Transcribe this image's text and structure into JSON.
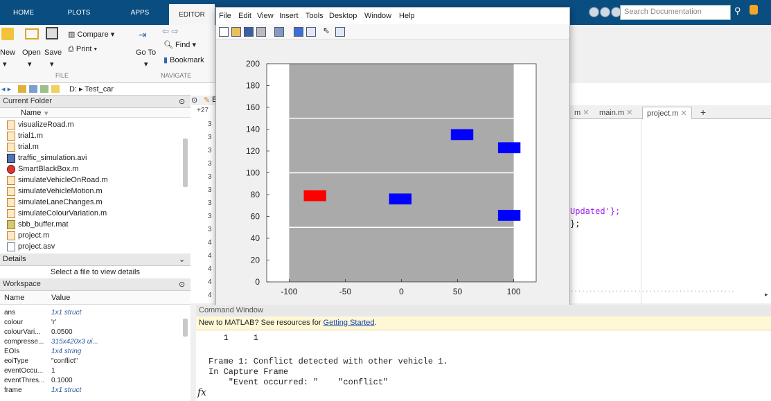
{
  "top_tabs": [
    "HOME",
    "PLOTS",
    "APPS",
    "EDITOR"
  ],
  "search": {
    "placeholder": "Search Documentation"
  },
  "ribbon": {
    "compare": "Compare",
    "new": "New",
    "open": "Open",
    "save": "Save",
    "print": "Print",
    "goto": "Go To",
    "find": "Find",
    "bookmark": "Bookmark",
    "group_file": "FILE",
    "group_navigate": "NAVIGATE"
  },
  "address": {
    "path": "D: ▸ Test_car"
  },
  "current_folder": {
    "title": "Current Folder",
    "column_name": "Name",
    "files": [
      {
        "name": "visualizeRoad.m",
        "type": "m"
      },
      {
        "name": "trial1.m",
        "type": "m"
      },
      {
        "name": "trial.m",
        "type": "m"
      },
      {
        "name": "traffic_simulation.avi",
        "type": "avi"
      },
      {
        "name": "SmartBlackBox.m",
        "type": "sbb"
      },
      {
        "name": "simulateVehicleOnRoad.m",
        "type": "m"
      },
      {
        "name": "simulateVehicleMotion.m",
        "type": "m"
      },
      {
        "name": "simulateLaneChanges.m",
        "type": "m"
      },
      {
        "name": "simulateColourVariation.m",
        "type": "m"
      },
      {
        "name": "sbb_buffer.mat",
        "type": "mat"
      },
      {
        "name": "project.m",
        "type": "m"
      },
      {
        "name": "project.asv",
        "type": "file"
      }
    ]
  },
  "details": {
    "title": "Details",
    "message": "Select a file to view details"
  },
  "workspace": {
    "title": "Workspace",
    "col_name": "Name",
    "col_value": "Value",
    "rows": [
      {
        "name": "ans",
        "value": "1x1 struct",
        "meta": true
      },
      {
        "name": "colour",
        "value": "'r'",
        "meta": false
      },
      {
        "name": "colourVari...",
        "value": "0.0500",
        "meta": false
      },
      {
        "name": "compresse...",
        "value": "315x420x3 ui...",
        "meta": true
      },
      {
        "name": "EOIs",
        "value": "1x4 string",
        "meta": true
      },
      {
        "name": "eoiType",
        "value": "\"conflict\"",
        "meta": false
      },
      {
        "name": "eventOccu...",
        "value": "1",
        "meta": false
      },
      {
        "name": "eventThres...",
        "value": "0.1000",
        "meta": false
      },
      {
        "name": "frame",
        "value": "1x1 struct",
        "meta": true
      }
    ]
  },
  "editor": {
    "partial_tab": "Ed",
    "tabs": [
      "m",
      "main.m",
      "project.m"
    ],
    "active_tab": "project.m",
    "line_numbers": [
      "+27",
      "3",
      "3",
      "3",
      "3",
      "3",
      "3",
      "3",
      "3",
      "3",
      "4",
      "4",
      "4",
      "4",
      "4"
    ],
    "code_line1": "Updated'};",
    "code_line2": "};"
  },
  "figure": {
    "menus": [
      "File",
      "Edit",
      "View",
      "Insert",
      "Tools",
      "Desktop",
      "Window",
      "Help"
    ]
  },
  "chart_data": {
    "type": "scatter",
    "xlim": [
      -120,
      120
    ],
    "ylim": [
      0,
      200
    ],
    "xticks": [
      -100,
      -50,
      0,
      50,
      100
    ],
    "yticks": [
      0,
      20,
      40,
      60,
      80,
      100,
      120,
      140,
      160,
      180,
      200
    ],
    "road": {
      "x_range": [
        -100,
        100
      ],
      "lane_lines_y": [
        50,
        100,
        150
      ],
      "color": "#aaaaaa"
    },
    "vehicles": [
      {
        "x": -77,
        "y": 79,
        "width": 20,
        "height": 10,
        "color": "#ff0000"
      },
      {
        "x": -1,
        "y": 76,
        "width": 20,
        "height": 10,
        "color": "#0000ff"
      },
      {
        "x": 54,
        "y": 135,
        "width": 20,
        "height": 10,
        "color": "#0000ff"
      },
      {
        "x": 96,
        "y": 123,
        "width": 20,
        "height": 10,
        "color": "#0000ff"
      },
      {
        "x": 96,
        "y": 61,
        "width": 20,
        "height": 10,
        "color": "#0000ff"
      }
    ],
    "grid": false
  },
  "command_window": {
    "title": "Command Window",
    "banner_prefix": "New to MATLAB? See resources for ",
    "banner_link": "Getting Started",
    "lines": [
      "   1     1",
      "",
      "Frame 1: Conflict detected with other vehicle 1.",
      "In Capture Frame",
      "    \"Event occurred: \"    \"conflict\""
    ],
    "prompt_symbol": "fx"
  }
}
